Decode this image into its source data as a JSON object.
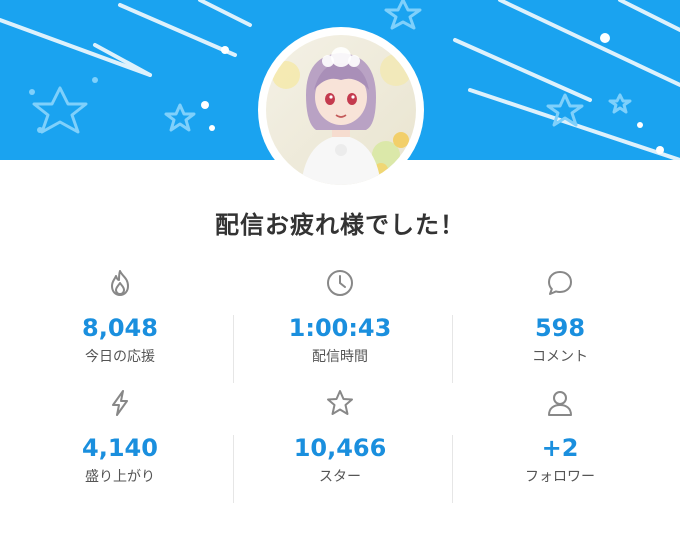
{
  "header": {
    "banner_color": "#1aa3f0",
    "avatar": "streamer-avatar"
  },
  "title": "配信お疲れ様でした！",
  "stats": [
    {
      "icon": "flame-icon",
      "value": "8,048",
      "label": "今日の応援"
    },
    {
      "icon": "clock-icon",
      "value": "1:00:43",
      "label": "配信時間"
    },
    {
      "icon": "comment-bubble-icon",
      "value": "598",
      "label": "コメント"
    },
    {
      "icon": "lightning-icon",
      "value": "4,140",
      "label": "盛り上がり"
    },
    {
      "icon": "star-icon",
      "value": "10,466",
      "label": "スター"
    },
    {
      "icon": "person-icon",
      "value": "+2",
      "label": "フォロワー"
    }
  ],
  "colors": {
    "value": "#1a8fde",
    "label": "#555555",
    "icon": "#888888"
  }
}
